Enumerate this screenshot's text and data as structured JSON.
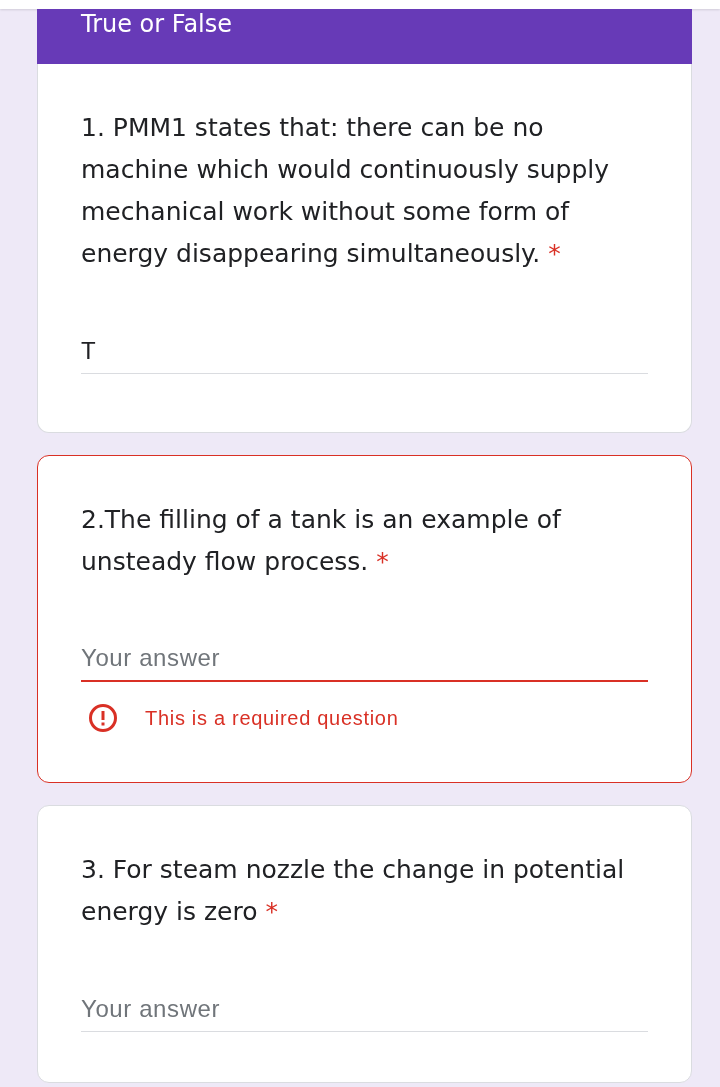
{
  "section": {
    "title": "True or False"
  },
  "questions": [
    {
      "text": "1. PMM1 states that: there can be no machine which would continuously supply mechanical work without some form of energy disappearing simultaneously.",
      "required_mark": "*",
      "answer": {
        "value": "T"
      },
      "invalid": false
    },
    {
      "text": "2.The filling of a tank is an example of unsteady flow process.",
      "required_mark": "*",
      "answer": {
        "placeholder": "Your answer"
      },
      "invalid": true,
      "error": "This is a required question"
    },
    {
      "text": "3. For steam nozzle the change in potential energy is zero",
      "required_mark": "*",
      "answer": {
        "placeholder": "Your answer"
      },
      "invalid": false
    }
  ]
}
